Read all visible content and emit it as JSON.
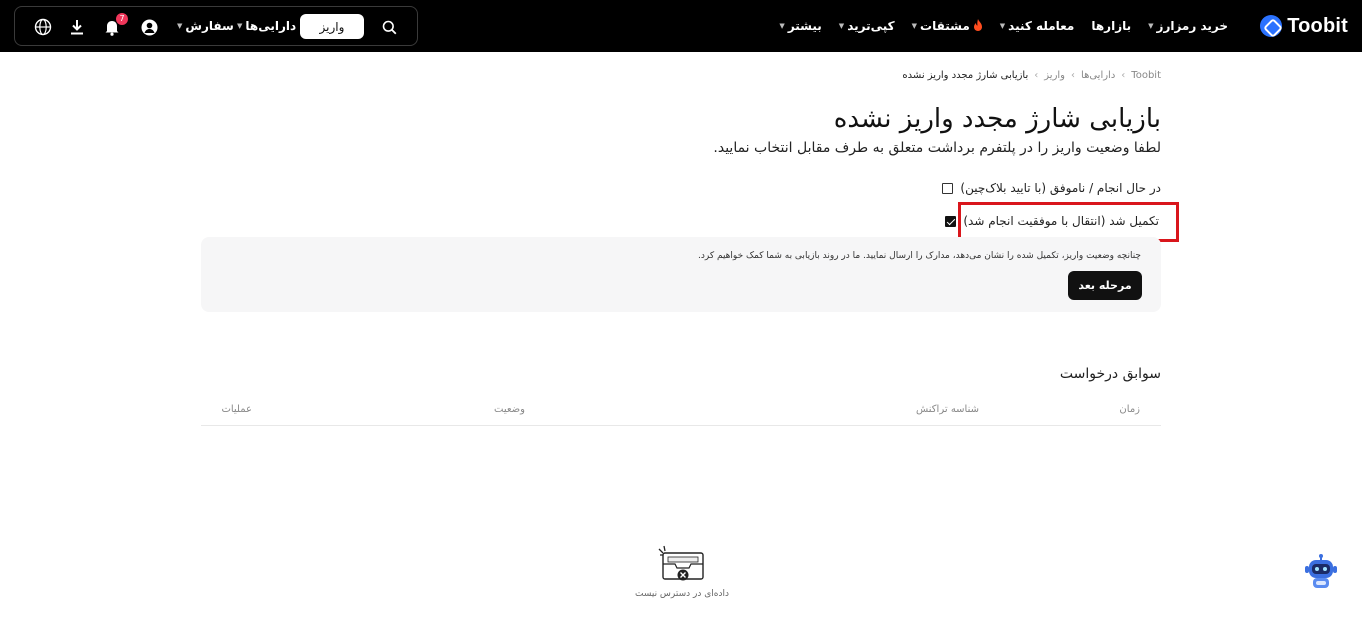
{
  "header": {
    "logo_text": "Toobit",
    "nav": [
      {
        "label": "خرید رمزارز",
        "caret": true
      },
      {
        "label": "بازارها",
        "caret": false
      },
      {
        "label": "معامله کنید",
        "caret": true
      },
      {
        "label": "مشتقات",
        "caret": true,
        "icon": "fire-icon"
      },
      {
        "label": "کپی‌ترید",
        "caret": true
      },
      {
        "label": "بیشتر",
        "caret": true
      }
    ],
    "search_icon": "search-icon",
    "deposit_button": "واریز",
    "assets_label": "دارایی‌ها",
    "orders_label": "سفارش",
    "notification_count": "7",
    "accent_badge_color": "#f0365a"
  },
  "breadcrumb": [
    "Toobit",
    "دارایی‌ها",
    "واریز",
    "بازیابی شارژ مجدد واریز نشده"
  ],
  "page": {
    "title": "بازیابی شارژ مجدد واریز نشده",
    "subtitle": "لطفا وضعیت واریز را در پلتفرم برداشت متعلق به طرف مقابل انتخاب نمایید.",
    "options": [
      {
        "label": "در حال انجام / ناموفق (با تایید بلاک‌چین)",
        "checked": false
      },
      {
        "label": "تکمیل شد (انتقال با موفقیت انجام شد)",
        "checked": true
      }
    ],
    "info_text": "چنانچه وضعیت واریز، تکمیل شده را نشان می‌دهد، مدارک را ارسال نمایید. ما در روند بازیابی به شما کمک خواهیم کرد.",
    "next_button": "مرحله بعد",
    "highlight_color": "#d9161c"
  },
  "history": {
    "title": "سوابق درخواست",
    "columns": [
      "زمان",
      "شناسه تراکنش",
      "وضعیت",
      "عملیات"
    ],
    "empty_text": "داده‌ای در دسترس نیست"
  }
}
